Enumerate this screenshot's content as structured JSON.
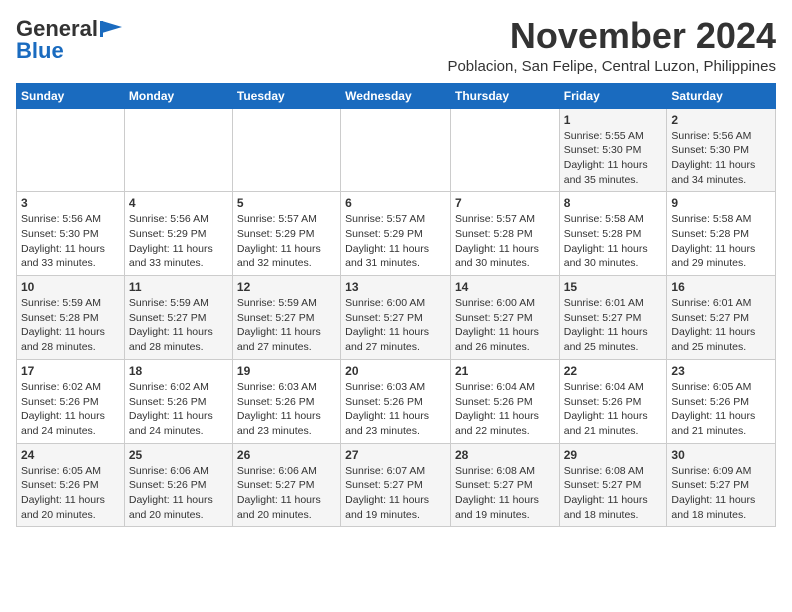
{
  "logo": {
    "general": "General",
    "blue": "Blue"
  },
  "title": "November 2024",
  "location": "Poblacion, San Felipe, Central Luzon, Philippines",
  "weekdays": [
    "Sunday",
    "Monday",
    "Tuesday",
    "Wednesday",
    "Thursday",
    "Friday",
    "Saturday"
  ],
  "weeks": [
    [
      {
        "day": "",
        "detail": ""
      },
      {
        "day": "",
        "detail": ""
      },
      {
        "day": "",
        "detail": ""
      },
      {
        "day": "",
        "detail": ""
      },
      {
        "day": "",
        "detail": ""
      },
      {
        "day": "1",
        "detail": "Sunrise: 5:55 AM\nSunset: 5:30 PM\nDaylight: 11 hours and 35 minutes."
      },
      {
        "day": "2",
        "detail": "Sunrise: 5:56 AM\nSunset: 5:30 PM\nDaylight: 11 hours and 34 minutes."
      }
    ],
    [
      {
        "day": "3",
        "detail": "Sunrise: 5:56 AM\nSunset: 5:30 PM\nDaylight: 11 hours and 33 minutes."
      },
      {
        "day": "4",
        "detail": "Sunrise: 5:56 AM\nSunset: 5:29 PM\nDaylight: 11 hours and 33 minutes."
      },
      {
        "day": "5",
        "detail": "Sunrise: 5:57 AM\nSunset: 5:29 PM\nDaylight: 11 hours and 32 minutes."
      },
      {
        "day": "6",
        "detail": "Sunrise: 5:57 AM\nSunset: 5:29 PM\nDaylight: 11 hours and 31 minutes."
      },
      {
        "day": "7",
        "detail": "Sunrise: 5:57 AM\nSunset: 5:28 PM\nDaylight: 11 hours and 30 minutes."
      },
      {
        "day": "8",
        "detail": "Sunrise: 5:58 AM\nSunset: 5:28 PM\nDaylight: 11 hours and 30 minutes."
      },
      {
        "day": "9",
        "detail": "Sunrise: 5:58 AM\nSunset: 5:28 PM\nDaylight: 11 hours and 29 minutes."
      }
    ],
    [
      {
        "day": "10",
        "detail": "Sunrise: 5:59 AM\nSunset: 5:28 PM\nDaylight: 11 hours and 28 minutes."
      },
      {
        "day": "11",
        "detail": "Sunrise: 5:59 AM\nSunset: 5:27 PM\nDaylight: 11 hours and 28 minutes."
      },
      {
        "day": "12",
        "detail": "Sunrise: 5:59 AM\nSunset: 5:27 PM\nDaylight: 11 hours and 27 minutes."
      },
      {
        "day": "13",
        "detail": "Sunrise: 6:00 AM\nSunset: 5:27 PM\nDaylight: 11 hours and 27 minutes."
      },
      {
        "day": "14",
        "detail": "Sunrise: 6:00 AM\nSunset: 5:27 PM\nDaylight: 11 hours and 26 minutes."
      },
      {
        "day": "15",
        "detail": "Sunrise: 6:01 AM\nSunset: 5:27 PM\nDaylight: 11 hours and 25 minutes."
      },
      {
        "day": "16",
        "detail": "Sunrise: 6:01 AM\nSunset: 5:27 PM\nDaylight: 11 hours and 25 minutes."
      }
    ],
    [
      {
        "day": "17",
        "detail": "Sunrise: 6:02 AM\nSunset: 5:26 PM\nDaylight: 11 hours and 24 minutes."
      },
      {
        "day": "18",
        "detail": "Sunrise: 6:02 AM\nSunset: 5:26 PM\nDaylight: 11 hours and 24 minutes."
      },
      {
        "day": "19",
        "detail": "Sunrise: 6:03 AM\nSunset: 5:26 PM\nDaylight: 11 hours and 23 minutes."
      },
      {
        "day": "20",
        "detail": "Sunrise: 6:03 AM\nSunset: 5:26 PM\nDaylight: 11 hours and 23 minutes."
      },
      {
        "day": "21",
        "detail": "Sunrise: 6:04 AM\nSunset: 5:26 PM\nDaylight: 11 hours and 22 minutes."
      },
      {
        "day": "22",
        "detail": "Sunrise: 6:04 AM\nSunset: 5:26 PM\nDaylight: 11 hours and 21 minutes."
      },
      {
        "day": "23",
        "detail": "Sunrise: 6:05 AM\nSunset: 5:26 PM\nDaylight: 11 hours and 21 minutes."
      }
    ],
    [
      {
        "day": "24",
        "detail": "Sunrise: 6:05 AM\nSunset: 5:26 PM\nDaylight: 11 hours and 20 minutes."
      },
      {
        "day": "25",
        "detail": "Sunrise: 6:06 AM\nSunset: 5:26 PM\nDaylight: 11 hours and 20 minutes."
      },
      {
        "day": "26",
        "detail": "Sunrise: 6:06 AM\nSunset: 5:27 PM\nDaylight: 11 hours and 20 minutes."
      },
      {
        "day": "27",
        "detail": "Sunrise: 6:07 AM\nSunset: 5:27 PM\nDaylight: 11 hours and 19 minutes."
      },
      {
        "day": "28",
        "detail": "Sunrise: 6:08 AM\nSunset: 5:27 PM\nDaylight: 11 hours and 19 minutes."
      },
      {
        "day": "29",
        "detail": "Sunrise: 6:08 AM\nSunset: 5:27 PM\nDaylight: 11 hours and 18 minutes."
      },
      {
        "day": "30",
        "detail": "Sunrise: 6:09 AM\nSunset: 5:27 PM\nDaylight: 11 hours and 18 minutes."
      }
    ]
  ]
}
